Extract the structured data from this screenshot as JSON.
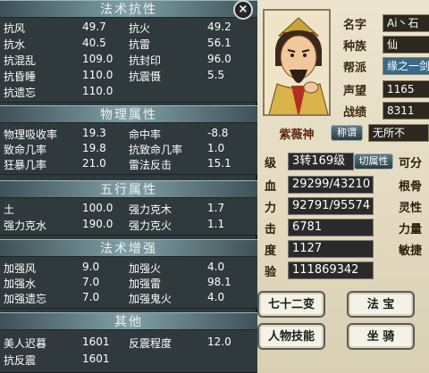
{
  "colors": {
    "panel_bg": "#303a3c",
    "header_bg": "#7fa0a6",
    "parchment": "#e3d9bf",
    "value_box": "#2a2a2a"
  },
  "close_icon": "×",
  "sections": [
    {
      "title": "法术抗性",
      "rows": [
        {
          "l1": "抗风",
          "v1": "49.7",
          "l2": "抗火",
          "v2": "49.2"
        },
        {
          "l1": "抗水",
          "v1": "40.5",
          "l2": "抗雷",
          "v2": "56.1"
        },
        {
          "l1": "抗混乱",
          "v1": "109.0",
          "l2": "抗封印",
          "v2": "96.0"
        },
        {
          "l1": "抗昏睡",
          "v1": "110.0",
          "l2": "抗震慑",
          "v2": "5.5"
        },
        {
          "l1": "抗遗忘",
          "v1": "110.0",
          "l2": "",
          "v2": ""
        }
      ]
    },
    {
      "title": "物理属性",
      "rows": [
        {
          "l1": "物理吸收率",
          "v1": "19.3",
          "l2": "命中率",
          "v2": "-8.8"
        },
        {
          "l1": "致命几率",
          "v1": "19.8",
          "l2": "抗致命几率",
          "v2": "1.0"
        },
        {
          "l1": "狂暴几率",
          "v1": "21.0",
          "l2": "雷法反击",
          "v2": "15.1"
        }
      ]
    },
    {
      "title": "五行属性",
      "rows": [
        {
          "l1": "土",
          "v1": "100.0",
          "l2": "强力克木",
          "v2": "1.7"
        },
        {
          "l1": "强力克水",
          "v1": "190.0",
          "l2": "强力克火",
          "v2": "1.1"
        }
      ]
    },
    {
      "title": "法术增强",
      "rows": [
        {
          "l1": "加强风",
          "v1": "9.0",
          "l2": "加强火",
          "v2": "4.0"
        },
        {
          "l1": "加强水",
          "v1": "7.0",
          "l2": "加强雷",
          "v2": "98.1"
        },
        {
          "l1": "加强遗忘",
          "v1": "7.0",
          "l2": "加强鬼火",
          "v2": "4.0"
        }
      ]
    },
    {
      "title": "其他",
      "rows": [
        {
          "l1": "美人迟暮",
          "v1": "1601",
          "l2": "反震程度",
          "v2": "12.0"
        },
        {
          "l1": "抗反震",
          "v1": "1601",
          "l2": "",
          "v2": ""
        }
      ]
    }
  ],
  "character": {
    "name": "紫薇神",
    "info": [
      {
        "label": "名字",
        "value": "Ai丶石"
      },
      {
        "label": "种族",
        "value": "仙"
      },
      {
        "label": "帮派",
        "value": "缘之一剑"
      },
      {
        "label": "声望",
        "value": "1165"
      },
      {
        "label": "战绩",
        "value": "8311"
      }
    ],
    "title_button": "称谓",
    "title_value": "无所不",
    "level_label": "级",
    "level_value": "3转169级",
    "switch_attr_button": "切属性",
    "side_note": "可分",
    "stats": [
      {
        "label": "血",
        "value": "29299/43210"
      },
      {
        "label": "力",
        "value": "92791/95574"
      },
      {
        "label": "击",
        "value": "6781"
      },
      {
        "label": "度",
        "value": "1127"
      },
      {
        "label": "验",
        "value": "111869342"
      }
    ],
    "side_labels": [
      "根骨",
      "灵性",
      "力量",
      "敏捷"
    ],
    "buttons": {
      "transform": "七十二变",
      "magic_item": "法  宝",
      "skills": "人物技能",
      "mount": "坐  骑"
    }
  }
}
